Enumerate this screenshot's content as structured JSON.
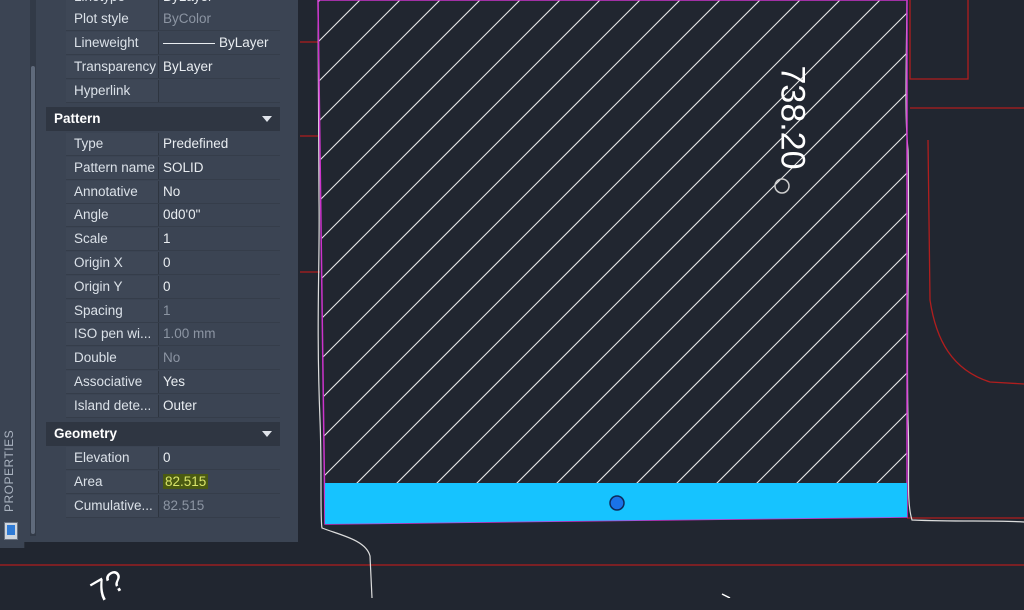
{
  "palette": {
    "title": "PROPERTIES",
    "icon": "properties-palette-icon"
  },
  "general_rows": [
    {
      "label": "Plot style",
      "value": "ByColor",
      "dim": true
    },
    {
      "label": "Lineweight",
      "value": "ByLayer",
      "dim": false
    },
    {
      "label": "Transparency",
      "value": "ByLayer",
      "dim": false
    },
    {
      "label": "Hyperlink",
      "value": "",
      "dim": false
    }
  ],
  "pattern_section": {
    "title": "Pattern",
    "rows": [
      {
        "label": "Type",
        "value": "Predefined",
        "dim": false
      },
      {
        "label": "Pattern name",
        "value": "SOLID",
        "dim": false
      },
      {
        "label": "Annotative",
        "value": "No",
        "dim": false
      },
      {
        "label": "Angle",
        "value": "0d0'0\"",
        "dim": false
      },
      {
        "label": "Scale",
        "value": "1",
        "dim": false
      },
      {
        "label": "Origin X",
        "value": "0",
        "dim": false
      },
      {
        "label": "Origin Y",
        "value": "0",
        "dim": false
      },
      {
        "label": "Spacing",
        "value": "1",
        "dim": true
      },
      {
        "label": "ISO pen wi...",
        "value": "1.00 mm",
        "dim": true
      },
      {
        "label": "Double",
        "value": "No",
        "dim": true
      },
      {
        "label": "Associative",
        "value": "Yes",
        "dim": false
      },
      {
        "label": "Island dete...",
        "value": "Outer",
        "dim": false
      }
    ]
  },
  "geometry_section": {
    "title": "Geometry",
    "rows": [
      {
        "label": "Elevation",
        "value": "0",
        "dim": false
      },
      {
        "label": "Area",
        "value": "82.515",
        "dim": false,
        "highlight": true
      },
      {
        "label": "Cumulative...",
        "value": "82.515",
        "dim": true
      }
    ]
  },
  "drawing": {
    "dimension_label": "738.20",
    "partial_label": "7?",
    "colors": {
      "background": "#212630",
      "hatch_lines": "#e8e8e8",
      "selection_fill": "#16c3ff",
      "boundary": "#cc33cc",
      "property_lines": "#b01e1e",
      "grip": "#1a73e8"
    }
  }
}
